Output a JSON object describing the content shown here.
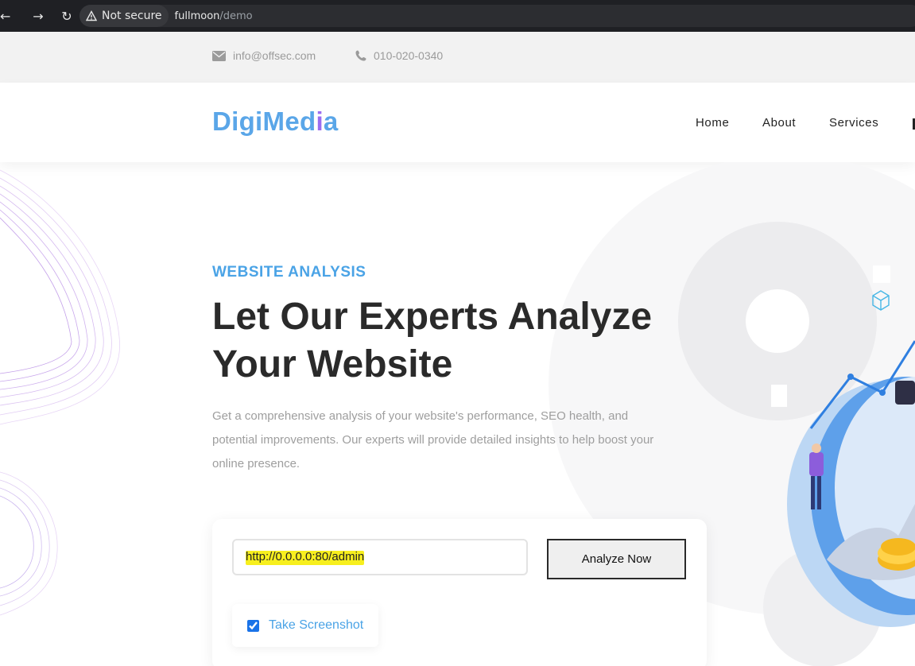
{
  "browser": {
    "security_label": "Not secure",
    "url_host": "fullmoon",
    "url_path": "/demo"
  },
  "topbar": {
    "email": "info@offsec.com",
    "phone": "010-020-0340"
  },
  "header": {
    "logo_part1": "DigiMed",
    "logo_part2": "i",
    "logo_part3": "a",
    "nav": [
      "Home",
      "About",
      "Services"
    ]
  },
  "hero": {
    "eyebrow": "WEBSITE ANALYSIS",
    "headline_line1": "Let Our Experts Analyze",
    "headline_line2": "Your Website",
    "lead": "Get a comprehensive analysis of your website's performance, SEO health, and potential improvements. Our experts will provide detailed insights to help boost your online presence."
  },
  "form": {
    "url_value": "http://0.0.0.0:80/admin",
    "submit_label": "Analyze Now",
    "screenshot_label": "Take Screenshot",
    "screenshot_checked": true
  },
  "colors": {
    "accent": "#4aa3e6",
    "logo_blue": "#5aa6e8",
    "logo_purple": "#9b6cf0"
  }
}
